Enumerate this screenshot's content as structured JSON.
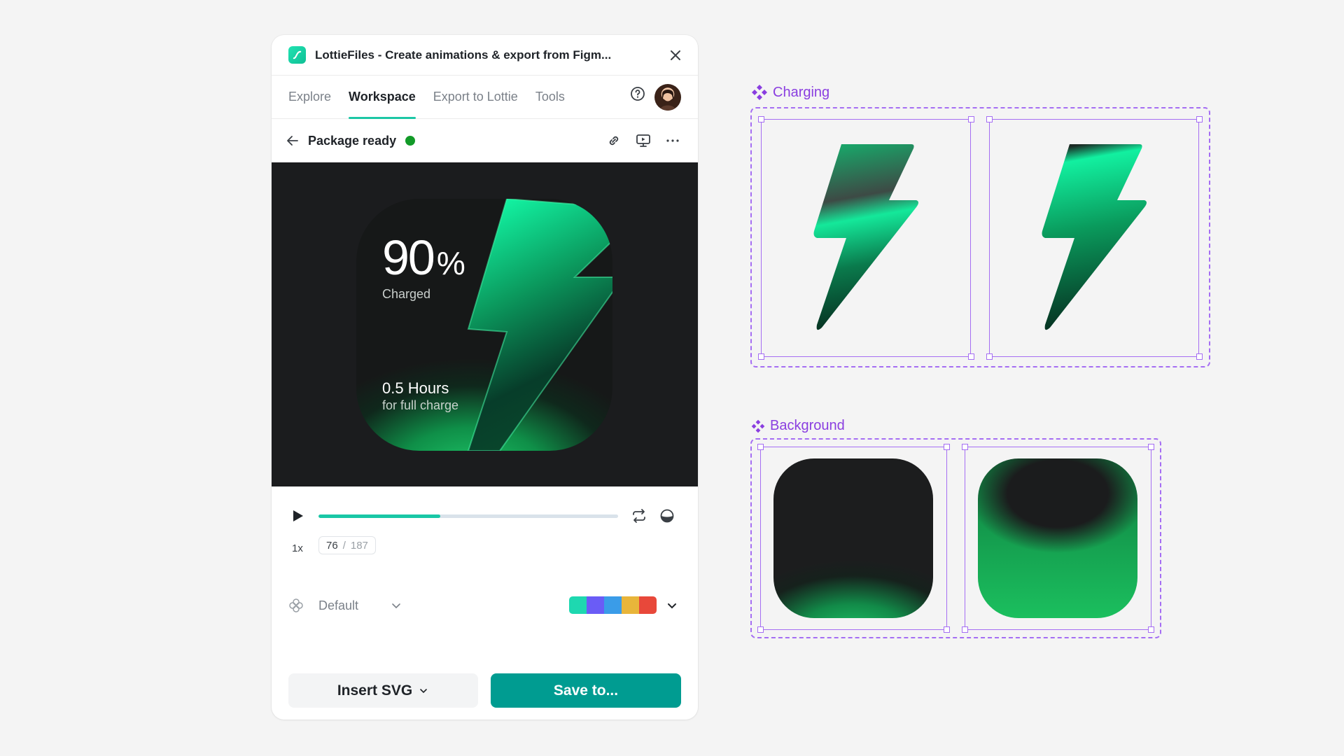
{
  "window": {
    "title": "LottieFiles - Create animations & export from Figm..."
  },
  "tabs": [
    {
      "label": "Explore",
      "active": false
    },
    {
      "label": "Workspace",
      "active": true
    },
    {
      "label": "Export to Lottie",
      "active": false
    },
    {
      "label": "Tools",
      "active": false
    }
  ],
  "subheader": {
    "title": "Package ready",
    "status_color": "#129a28"
  },
  "preview": {
    "percent": "90",
    "percent_sign": "%",
    "charged_label": "Charged",
    "hours": "0.5 Hours",
    "hours_caption": "for full charge"
  },
  "player": {
    "progress_fraction": 0.406,
    "speed": "1x",
    "current_frame": "76",
    "separator": "/",
    "total_frames": "187"
  },
  "theme": {
    "selected": "Default",
    "swatches": [
      "#1ed8b0",
      "#6a5cf6",
      "#3a9ce8",
      "#e8b53a",
      "#e8483a"
    ]
  },
  "actions": {
    "insert_label": "Insert SVG",
    "save_label": "Save to..."
  },
  "canvas": {
    "component_a": "Charging",
    "component_b": "Background",
    "accent_color": "#8a3ee0"
  },
  "icons": [
    "lottie-logo-icon",
    "close-icon",
    "help-icon",
    "back-arrow-icon",
    "link-icon",
    "present-icon",
    "more-icon",
    "play-icon",
    "loop-icon",
    "background-toggle-icon",
    "theme-icon",
    "chevron-down-icon",
    "component-icon"
  ]
}
